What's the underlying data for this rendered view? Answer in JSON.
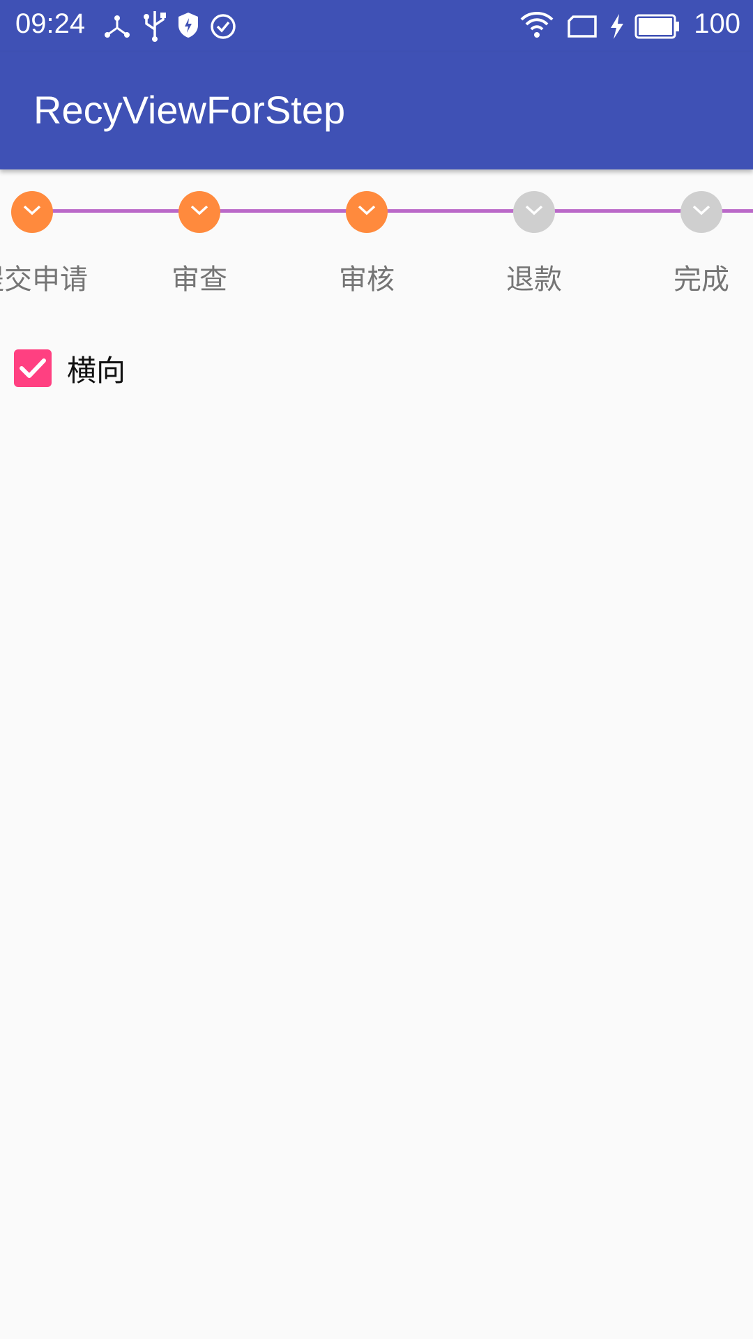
{
  "status_bar": {
    "time": "09:24",
    "battery_level": "100",
    "icons": [
      "usb-share-icon",
      "usb-icon",
      "shield-icon",
      "check-circle-icon",
      "wifi-icon",
      "sim-card-icon",
      "charging-icon",
      "battery-icon"
    ]
  },
  "app_bar": {
    "title": "RecyViewForStep",
    "color": "#3f51b5"
  },
  "stepper": {
    "line_color": "#ba68c8",
    "completed_color": "#ff8a3d",
    "pending_color": "#cfcfcf",
    "steps": [
      {
        "label": "提交申请",
        "completed": true
      },
      {
        "label": "审查",
        "completed": true
      },
      {
        "label": "审核",
        "completed": true
      },
      {
        "label": "退款",
        "completed": false
      },
      {
        "label": "完成",
        "completed": false
      }
    ]
  },
  "orientation_checkbox": {
    "label": "横向",
    "checked": true,
    "color": "#ff4081"
  }
}
